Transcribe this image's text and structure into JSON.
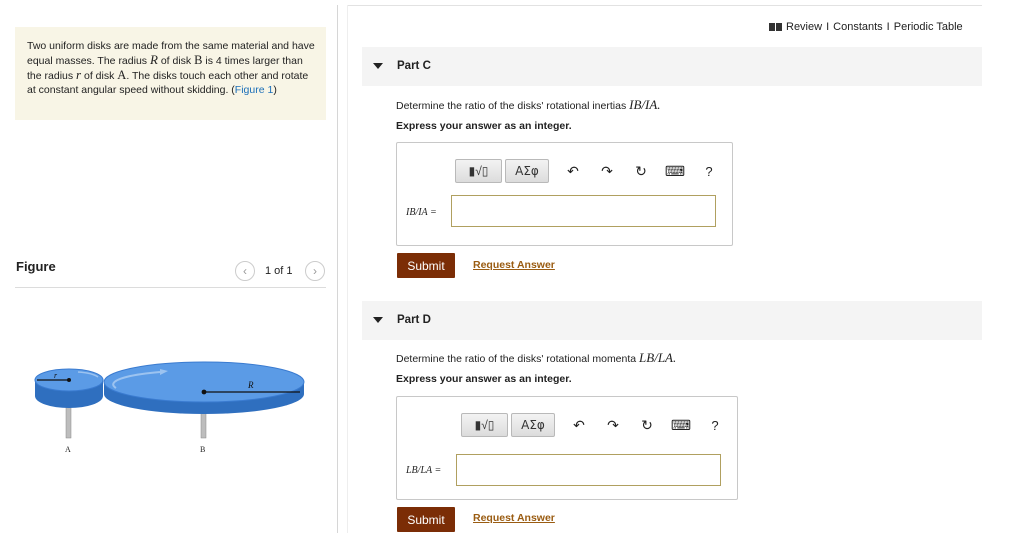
{
  "problem": {
    "text_1": "Two uniform disks are made from the same material and have equal masses. The radius ",
    "var_R": "R",
    "text_2": " of disk ",
    "disk_B": "B",
    "text_3": " is 4 times larger than the radius ",
    "var_r": "r",
    "text_4": " of disk ",
    "disk_A": "A",
    "text_5": ". The disks touch each other and rotate at constant angular speed without skidding. (",
    "figure_link": "Figure 1",
    "text_6": ")"
  },
  "figure": {
    "label": "Figure",
    "pager": "1 of 1",
    "prev_icon": "chevron-left-icon",
    "next_icon": "chevron-right-icon",
    "label_R": "R",
    "label_r": "r",
    "label_A": "A",
    "label_B": "B",
    "disk_color": "#4a90e2"
  },
  "header": {
    "review": "Review",
    "sep1": "I",
    "constants": "Constants",
    "sep2": "I",
    "periodic": "Periodic Table"
  },
  "toolbar": {
    "template_icon": "▮√▯",
    "greek": "ΑΣφ",
    "undo_icon": "↶",
    "redo_icon": "↷",
    "reset_icon": "↻",
    "keyboard_icon": "⌨",
    "help": "?"
  },
  "partC": {
    "title": "Part C",
    "question_text": "Determine the ratio of the disks' rotational inertias ",
    "question_math": "IB/IA.",
    "instruction": "Express your answer as an integer.",
    "answer_label": "IB/IA =",
    "answer_value": "",
    "submit": "Submit",
    "request": "Request Answer"
  },
  "partD": {
    "title": "Part D",
    "question_text": "Determine the ratio of the disks' rotational momenta ",
    "question_math": "LB/LA.",
    "instruction": "Express your answer as an integer.",
    "answer_label": "LB/LA =",
    "answer_value": "",
    "submit": "Submit",
    "request": "Request Answer"
  },
  "colors": {
    "submit_bg": "#7b2d06",
    "link": "#9a5c12",
    "problem_bg": "#f8f5e6",
    "figure_link": "#1c6fb8"
  }
}
